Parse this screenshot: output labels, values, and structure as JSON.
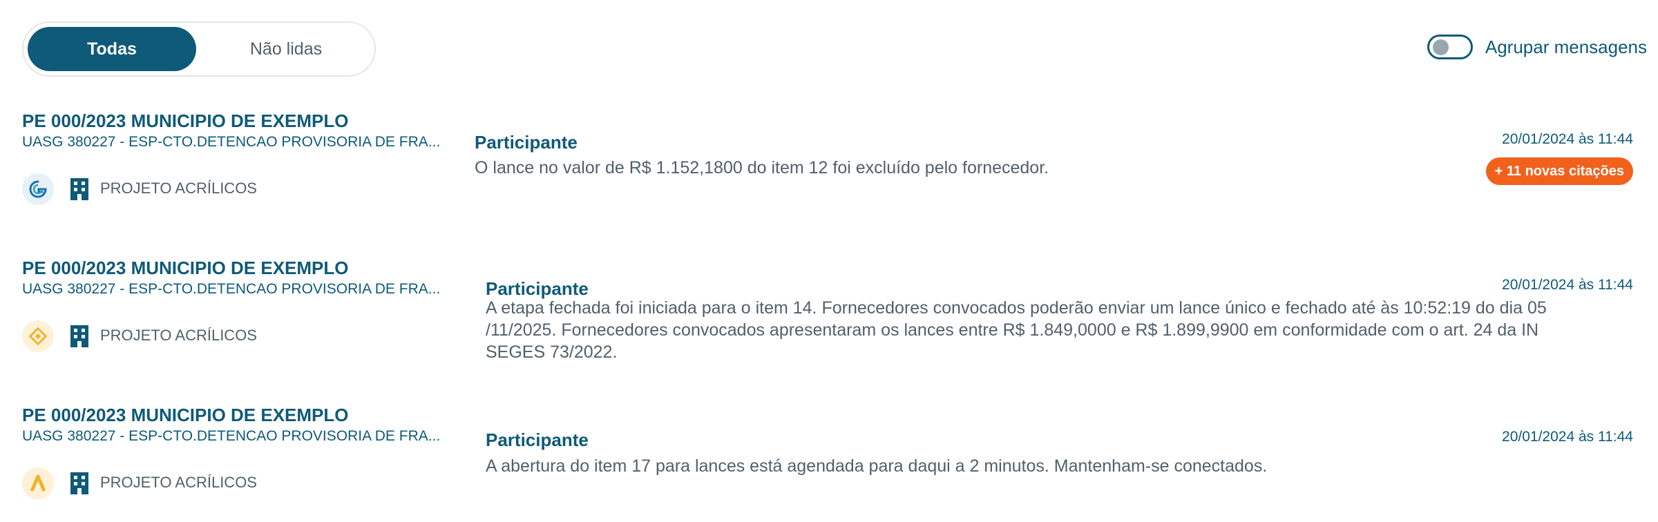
{
  "filter_tabs": {
    "all_label": "Todas",
    "unread_label": "Não lidas"
  },
  "group_toggle": {
    "label": "Agrupar mensagens",
    "checked": false
  },
  "messages": [
    {
      "title": "PE 000/2023 MUNICIPIO DE EXEMPLO",
      "subtitle": "UASG 380227 - ESP-CTO.DETENCAO PROVISORIA DE FRA...",
      "platform_icon": "gov-platform-icon",
      "project": "PROJETO ACRÍLICOS",
      "sender": "Participante",
      "date": "20/01/2024 às 11:44",
      "text": "O lance no valor de R$ 1.152,1800 do item 12 foi excluído pelo fornecedor.",
      "badge": "+ 11 novas citações"
    },
    {
      "title": "PE 000/2023 MUNICIPIO DE EXEMPLO",
      "subtitle": "UASG 380227 - ESP-CTO.DETENCAO PROVISORIA DE FRA...",
      "platform_icon": "diamond-platform-icon",
      "project": "PROJETO ACRÍLICOS",
      "sender": "Participante",
      "date": "20/01/2024 às 11:44",
      "text_lines": [
        "A etapa fechada foi iniciada para o item 14. Fornecedores convocados poderão enviar um lance único e fechado até às 10:52:19 do dia 05",
        "/11/2025. Fornecedores convocados apresentaram os lances entre R$ 1.849,0000 e R$ 1.899,9900 em conformidade com o art. 24 da IN",
        "SEGES 73/2022."
      ]
    },
    {
      "title": "PE 000/2023 MUNICIPIO DE EXEMPLO",
      "subtitle": "UASG 380227 - ESP-CTO.DETENCAO PROVISORIA DE FRA...",
      "platform_icon": "chevron-platform-icon",
      "project": "PROJETO ACRÍLICOS",
      "sender": "Participante",
      "date": "20/01/2024 às 11:44",
      "text": "A abertura do item 17 para lances está agendada para daqui a 2 minutos. Mantenham-se conectados."
    }
  ],
  "colors": {
    "primary": "#0e5a78",
    "text_muted": "#52606b",
    "badge": "#f2611c",
    "border": "#e3e7ea"
  }
}
